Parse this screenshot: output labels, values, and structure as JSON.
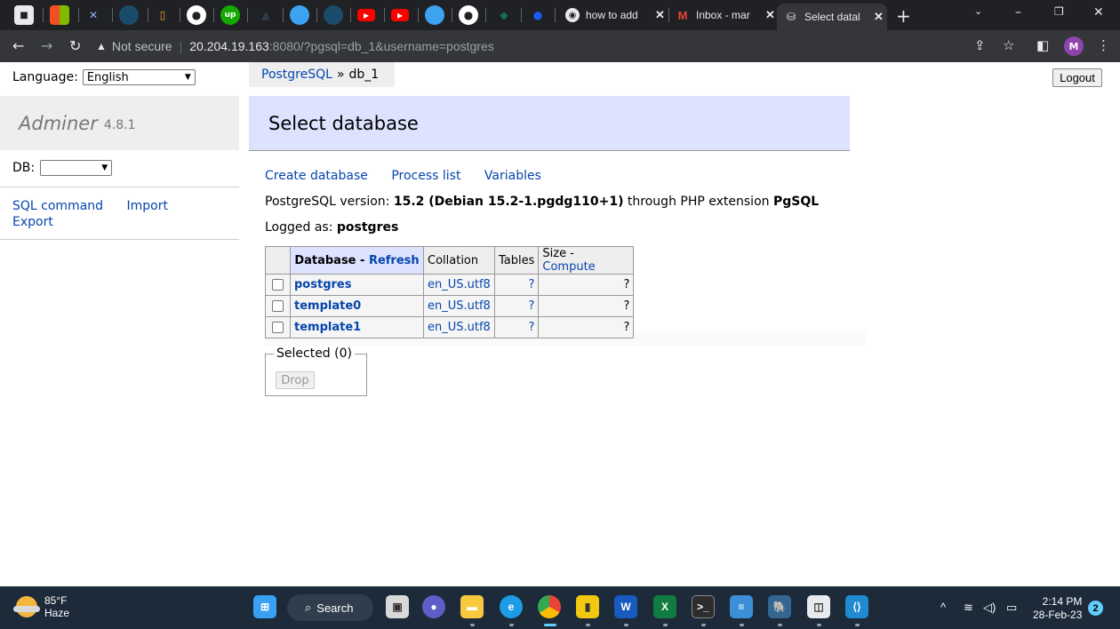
{
  "browser": {
    "tabs": [
      {
        "title": "how to add",
        "favicon": "chrome-logo-icon"
      },
      {
        "title": "Inbox - mar",
        "favicon": "gmail-icon"
      },
      {
        "title": "Select datal",
        "favicon": "adminer-icon",
        "active": true
      }
    ],
    "address": {
      "security_label": "Not secure",
      "host": "20.204.19.163",
      "rest": ":8080/?pgsql=db_1&username=postgres"
    },
    "profile_initial": "M"
  },
  "adminer": {
    "language_label": "Language:",
    "language_value": "English",
    "breadcrumb": {
      "root": "PostgreSQL",
      "sep": "»",
      "db": "db_1"
    },
    "logout_label": "Logout",
    "logo": "Adminer",
    "version": "4.8.1",
    "db_label": "DB:",
    "db_value": "",
    "menu": {
      "sql_command": "SQL command",
      "import": "Import",
      "export": "Export"
    },
    "heading": "Select database",
    "links": {
      "create_database": "Create database",
      "process_list": "Process list",
      "variables": "Variables"
    },
    "version_line": {
      "prefix": "PostgreSQL version: ",
      "version": "15.2 (Debian 15.2-1.pgdg110+1)",
      "middle": " through PHP extension ",
      "extension": "PgSQL"
    },
    "logged_line": {
      "prefix": "Logged as: ",
      "user": "postgres"
    },
    "table": {
      "headers": {
        "database": "Database",
        "dash1": " - ",
        "refresh": "Refresh",
        "collation": "Collation",
        "tables": "Tables",
        "size": "Size",
        "dash2": " - ",
        "compute": "Compute"
      },
      "rows": [
        {
          "name": "postgres",
          "collation": "en_US.utf8",
          "tables": "?",
          "size": "?"
        },
        {
          "name": "template0",
          "collation": "en_US.utf8",
          "tables": "?",
          "size": "?"
        },
        {
          "name": "template1",
          "collation": "en_US.utf8",
          "tables": "?",
          "size": "?"
        }
      ]
    },
    "selected_legend": "Selected (0)",
    "drop_label": "Drop"
  },
  "taskbar": {
    "weather_temp": "85°F",
    "weather_desc": "Haze",
    "search_label": "Search",
    "time": "2:14 PM",
    "date": "28-Feb-23",
    "notifications": "2"
  }
}
